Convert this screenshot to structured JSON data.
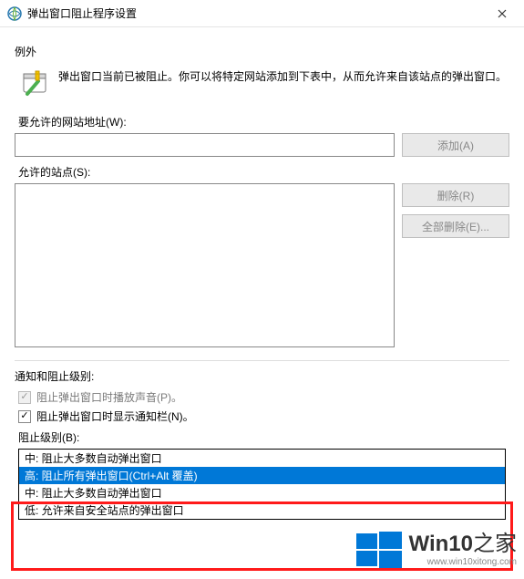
{
  "titlebar": {
    "title": "弹出窗口阻止程序设置"
  },
  "exceptions": {
    "heading": "例外",
    "info": "弹出窗口当前已被阻止。你可以将特定网站添加到下表中，从而允许来自该站点的弹出窗口。",
    "address_label": "要允许的网站地址(W):",
    "address_value": "",
    "add_btn": "添加(A)",
    "allowed_label": "允许的站点(S):",
    "remove_btn": "删除(R)",
    "remove_all_btn": "全部删除(E)..."
  },
  "notify": {
    "heading": "通知和阻止级别:",
    "sound_label": "阻止弹出窗口时播放声音(P)。",
    "sound_checked": true,
    "sound_enabled": false,
    "bar_label": "阻止弹出窗口时显示通知栏(N)。",
    "bar_checked": true,
    "bar_enabled": true,
    "level_label": "阻止级别(B):"
  },
  "level_options": [
    "中: 阻止大多数自动弹出窗口",
    "高: 阻止所有弹出窗口(Ctrl+Alt 覆盖)",
    "中: 阻止大多数自动弹出窗口",
    "低: 允许来自安全站点的弹出窗口"
  ],
  "level_selected_index": 1,
  "watermark": {
    "brand_a": "Win10",
    "brand_b": "之家",
    "url": "www.win10xitong.com"
  }
}
